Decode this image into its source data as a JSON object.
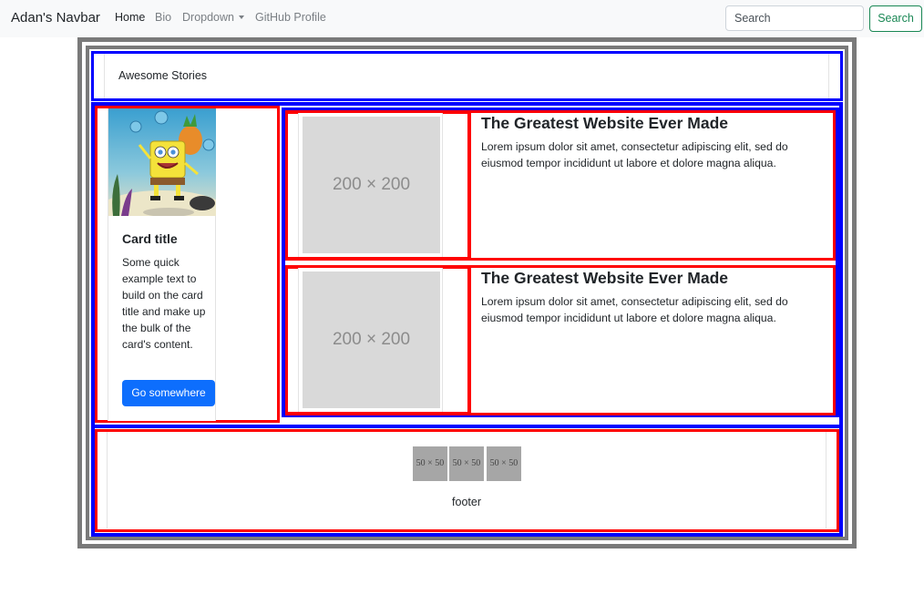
{
  "navbar": {
    "brand": "Adan's Navbar",
    "links": [
      "Home",
      "Bio",
      "Dropdown",
      "GitHub Profile"
    ],
    "search_placeholder": "Search",
    "search_button": "Search"
  },
  "header": {
    "title": "Awesome Stories"
  },
  "card": {
    "title": "Card title",
    "text": "Some quick example text to build on the card title and make up the bulk of the card's content.",
    "button": "Go somewhere"
  },
  "media_items": [
    {
      "placeholder": "200 × 200",
      "title": "The Greatest Website Ever Made",
      "text": "Lorem ipsum dolor sit amet, consectetur adipiscing elit, sed do eiusmod tempor incididunt ut labore et dolore magna aliqua."
    },
    {
      "placeholder": "200 × 200",
      "title": "The Greatest Website Ever Made",
      "text": "Lorem ipsum dolor sit amet, consectetur adipiscing elit, sed do eiusmod tempor incididunt ut labore et dolore magna aliqua."
    }
  ],
  "footer": {
    "thumbnails": [
      "50 × 50",
      "50 × 50",
      "50 × 50"
    ],
    "text": "footer"
  },
  "colors": {
    "frame_blue": "#0000ff",
    "frame_red": "#ff0000",
    "frame_gray": "#7a7a7a",
    "primary": "#0d6efd",
    "success": "#198754"
  }
}
